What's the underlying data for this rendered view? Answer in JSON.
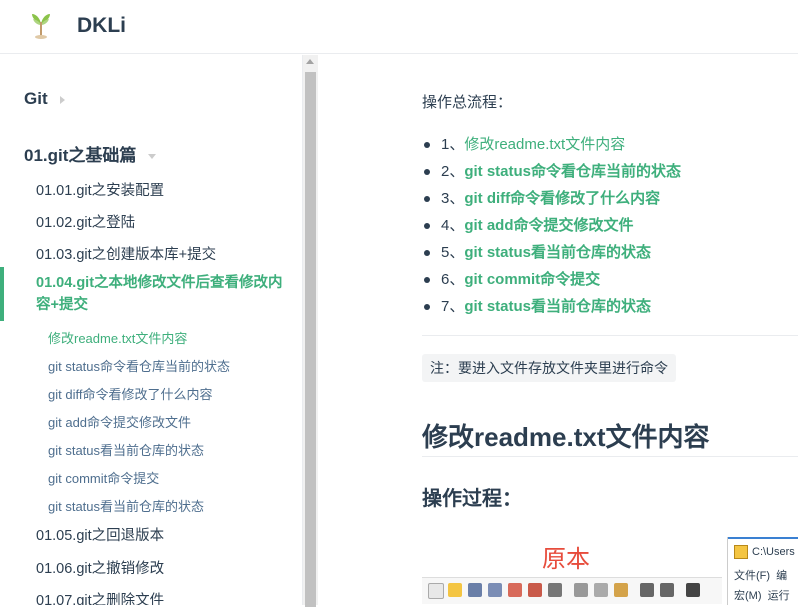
{
  "header": {
    "site_name": "DKLi"
  },
  "sidebar": {
    "group1": "Git",
    "group2": "01.git之基础篇",
    "links": [
      "01.01.git之安装配置",
      "01.02.git之登陆",
      "01.03.git之创建版本库+提交",
      "01.04.git之本地修改文件后查看修改内容+提交"
    ],
    "sub_links": [
      "修改readme.txt文件内容",
      "git status命令看仓库当前的状态",
      "git diff命令看修改了什么内容",
      "git add命令提交修改文件",
      "git status看当前仓库的状态",
      "git commit命令提交",
      "git status看当前仓库的状态"
    ],
    "links_after": [
      "01.05.git之回退版本",
      "01.06.git之撤销修改",
      "01.07.git之删除文件"
    ]
  },
  "content": {
    "intro": "操作总流程：",
    "toc": [
      {
        "num": "1、",
        "text": "修改readme.txt文件内容"
      },
      {
        "num": "2、",
        "text": "git status命令看仓库当前的状态"
      },
      {
        "num": "3、",
        "text": "git diff命令看修改了什么内容"
      },
      {
        "num": "4、",
        "text": "git add命令提交修改文件"
      },
      {
        "num": "5、",
        "text": "git status看当前仓库的状态"
      },
      {
        "num": "6、",
        "text": "git commit命令提交"
      },
      {
        "num": "7、",
        "text": "git status看当前仓库的状态"
      }
    ],
    "note": "注：要进入文件存放文件夹里进行命令",
    "h2": "修改readme.txt文件内容",
    "h3": "操作过程：",
    "figure_label": "原本",
    "editor": {
      "title": "C:\\Users",
      "menu_file": "文件(F)",
      "menu_edit": "编",
      "menu_macro": "宏(M)",
      "menu_run": "运行"
    }
  },
  "colors": {
    "accent": "#3eaf7c",
    "text": "#2c3e50",
    "red": "#e74c3c"
  }
}
